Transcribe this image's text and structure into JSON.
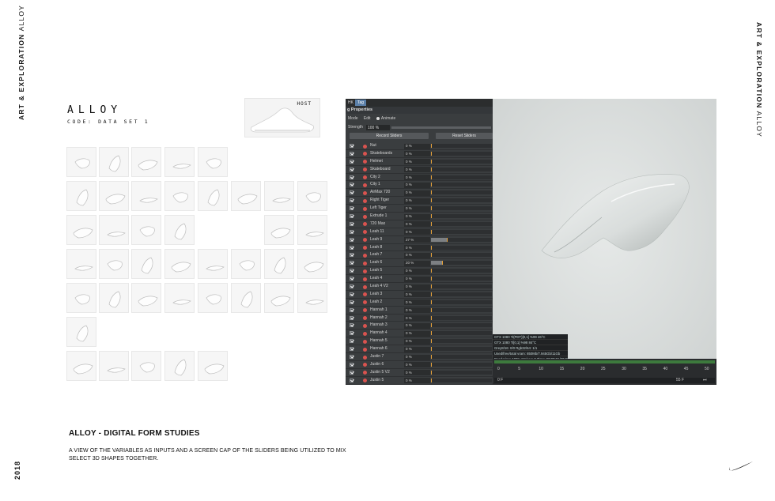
{
  "side_label_left": {
    "bold": "ART & EXPLORATION",
    "light": "ALLOY"
  },
  "side_label_right": {
    "bold": "ART & EXPLORATION",
    "light": "ALLOY"
  },
  "year": "2018",
  "title": "ALLOY",
  "subtitle": "CODE: DATA SET 1",
  "host_label": "HOST",
  "screen": {
    "tabs": [
      "HK",
      "Tag"
    ],
    "properties_title": "g Properties",
    "mode_label": "Mode",
    "mode_edit": "Edit",
    "mode_animate": "Animate",
    "strength_label": "Strength",
    "strength_value": "100 %",
    "record_button": "Record Sliders",
    "reset_button": "Reset Sliders",
    "sliders": [
      {
        "name": "Nut",
        "value": "0 %",
        "fill": 0
      },
      {
        "name": "Skateboards",
        "value": "0 %",
        "fill": 0
      },
      {
        "name": "Helmet",
        "value": "0 %",
        "fill": 0
      },
      {
        "name": "Skateboard",
        "value": "0 %",
        "fill": 0
      },
      {
        "name": "City 2",
        "value": "0 %",
        "fill": 0
      },
      {
        "name": "City 1",
        "value": "0 %",
        "fill": 0
      },
      {
        "name": "AirMax 720",
        "value": "0 %",
        "fill": 0
      },
      {
        "name": "Right Tiger",
        "value": "0 %",
        "fill": 0
      },
      {
        "name": "Left Tiger",
        "value": "0 %",
        "fill": 0
      },
      {
        "name": "Extrude 1",
        "value": "0 %",
        "fill": 0
      },
      {
        "name": "720 Max",
        "value": "0 %",
        "fill": 0
      },
      {
        "name": "Leah 11",
        "value": "0 %",
        "fill": 0
      },
      {
        "name": "Leah 9",
        "value": "27 %",
        "fill": 0.27
      },
      {
        "name": "Leah 8",
        "value": "0 %",
        "fill": 0
      },
      {
        "name": "Leah 7",
        "value": "0 %",
        "fill": 0
      },
      {
        "name": "Leah 6",
        "value": "20 %",
        "fill": 0.2
      },
      {
        "name": "Leah 5",
        "value": "0 %",
        "fill": 0
      },
      {
        "name": "Leah 4",
        "value": "0 %",
        "fill": 0
      },
      {
        "name": "Leah 4 V2",
        "value": "0 %",
        "fill": 0
      },
      {
        "name": "Leah 3",
        "value": "0 %",
        "fill": 0
      },
      {
        "name": "Leah 2",
        "value": "0 %",
        "fill": 0
      },
      {
        "name": "Hannah 1",
        "value": "0 %",
        "fill": 0
      },
      {
        "name": "Hannah 2",
        "value": "0 %",
        "fill": 0
      },
      {
        "name": "Hannah 3",
        "value": "0 %",
        "fill": 0
      },
      {
        "name": "Hannah 4",
        "value": "0 %",
        "fill": 0
      },
      {
        "name": "Hannah 5",
        "value": "0 %",
        "fill": 0
      },
      {
        "name": "Hannah 6",
        "value": "0 %",
        "fill": 0
      },
      {
        "name": "Justin 7",
        "value": "0 %",
        "fill": 0
      },
      {
        "name": "Justin 6",
        "value": "0 %",
        "fill": 0
      },
      {
        "name": "Justin 5 V2",
        "value": "0 %",
        "fill": 0
      },
      {
        "name": "Justin 5",
        "value": "0 %",
        "fill": 0
      }
    ],
    "stats": [
      "GTX 1080 Ti(PDT)[0,1]   %99   46°C",
      "GTX 1080 Ti[0,1]        %98   84°C",
      "Grey8/16: 0/0     Rgb32/64: 1/1",
      "Used/free/total vram: 850Mb/7.945Gb/11Gb",
      "Rendering: 100%  Ms/sec: 0  Time: 00:00:01/00:00:01  Spp/maxspp: 300/300"
    ],
    "timeline_ticks": [
      "0",
      "5",
      "10",
      "15",
      "20",
      "25",
      "30",
      "35",
      "40",
      "45",
      "50"
    ],
    "frame_start": "0 F",
    "frame_end": "55 F"
  },
  "heading": "ALLOY - DIGITAL FORM STUDIES",
  "description": "A VIEW OF THE VARIABLES AS INPUTS AND A SCREEN CAP OF THE SLIDERS BEING UTILIZED TO MIX SELECT 3D SHAPES TOGETHER."
}
